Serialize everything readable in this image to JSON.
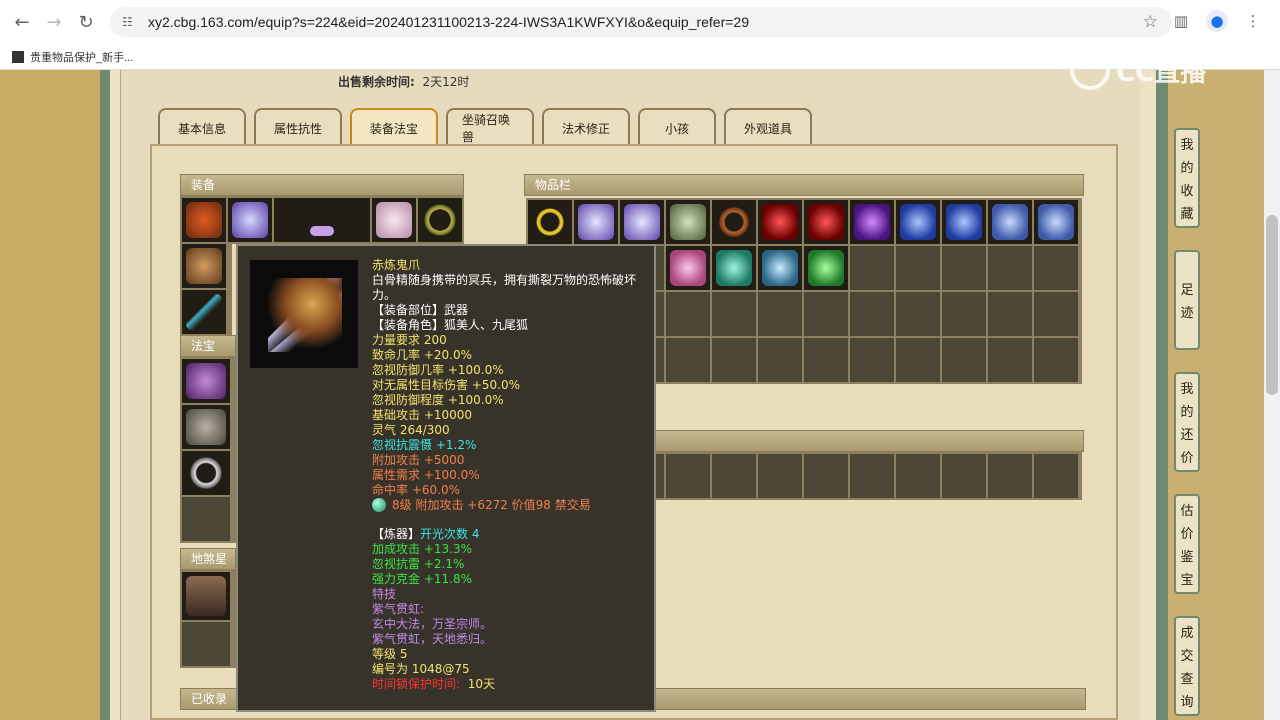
{
  "browser": {
    "url": "xy2.cbg.163.com/equip?s=224&eid=202401231100213-224-IWS3A1KWFXYI&o&equip_refer=29",
    "bookmark": "贵重物品保护_新手..."
  },
  "page": {
    "sale_time_label": "出售剩余时间:",
    "sale_time_value": "2天12时",
    "watermark": "CC直播"
  },
  "tabs": [
    "基本信息",
    "属性抗性",
    "装备法宝",
    "坐骑召唤兽",
    "法术修正",
    "小孩",
    "外观道具"
  ],
  "sections": {
    "equip": "装备",
    "inventory": "物品栏",
    "fabao": "法宝",
    "dishaxing": "地煞星",
    "collected": "已收录"
  },
  "sidebar": [
    {
      "label": "我的收藏",
      "chars": [
        "我",
        "的",
        "收",
        "藏"
      ]
    },
    {
      "label": "足迹",
      "chars": [
        "足",
        "迹"
      ]
    },
    {
      "label": "我的还价",
      "chars": [
        "我",
        "的",
        "还",
        "价"
      ]
    },
    {
      "label": "估价鉴宝",
      "chars": [
        "估",
        "价",
        "鉴",
        "宝"
      ]
    },
    {
      "label": "成交查询",
      "chars": [
        "成",
        "交",
        "查",
        "询"
      ]
    }
  ],
  "tooltip": {
    "name": "赤炼鬼爪",
    "desc": "白骨精随身携带的冥兵，拥有撕裂万物的恐怖破坏力。",
    "slot": "【装备部位】武器",
    "role": "【装备角色】狐美人、九尾狐",
    "stats": [
      {
        "text": "力量要求 200",
        "color": "c-y"
      },
      {
        "text": "致命几率 +20.0%",
        "color": "c-y"
      },
      {
        "text": "忽视防御几率 +100.0%",
        "color": "c-y"
      },
      {
        "text": "对无属性目标伤害 +50.0%",
        "color": "c-y"
      },
      {
        "text": "忽视防御程度 +100.0%",
        "color": "c-y"
      },
      {
        "text": "基础攻击 +10000",
        "color": "c-y"
      },
      {
        "text": "灵气 264/300",
        "color": "c-y"
      },
      {
        "text": "忽视抗震慑 +1.2%",
        "color": "c-b"
      },
      {
        "text": "附加攻击 +5000",
        "color": "c-o"
      },
      {
        "text": "属性需求 +100.0%",
        "color": "c-o"
      },
      {
        "text": "命中率 +60.0%",
        "color": "c-o"
      }
    ],
    "gem_line": "8级 附加攻击 +6272 价值98 禁交易",
    "refine_label": "【炼器】",
    "refine_count": "开光次数 4",
    "refine_stats": [
      {
        "text": "加成攻击 +13.3%",
        "color": "c-g"
      },
      {
        "text": "忽视抗雷 +2.1%",
        "color": "c-g"
      },
      {
        "text": "强力克金 +11.8%",
        "color": "c-g"
      }
    ],
    "skill_label": "特技",
    "skill_lines": [
      "紫气贯虹:",
      "玄中大法，万圣宗师。",
      "紫气贯虹，天地悉归。"
    ],
    "level": "等级 5",
    "serial": "编号为 1048@75",
    "protect_label": "时间锁保护时间:",
    "protect_value": "10天"
  }
}
